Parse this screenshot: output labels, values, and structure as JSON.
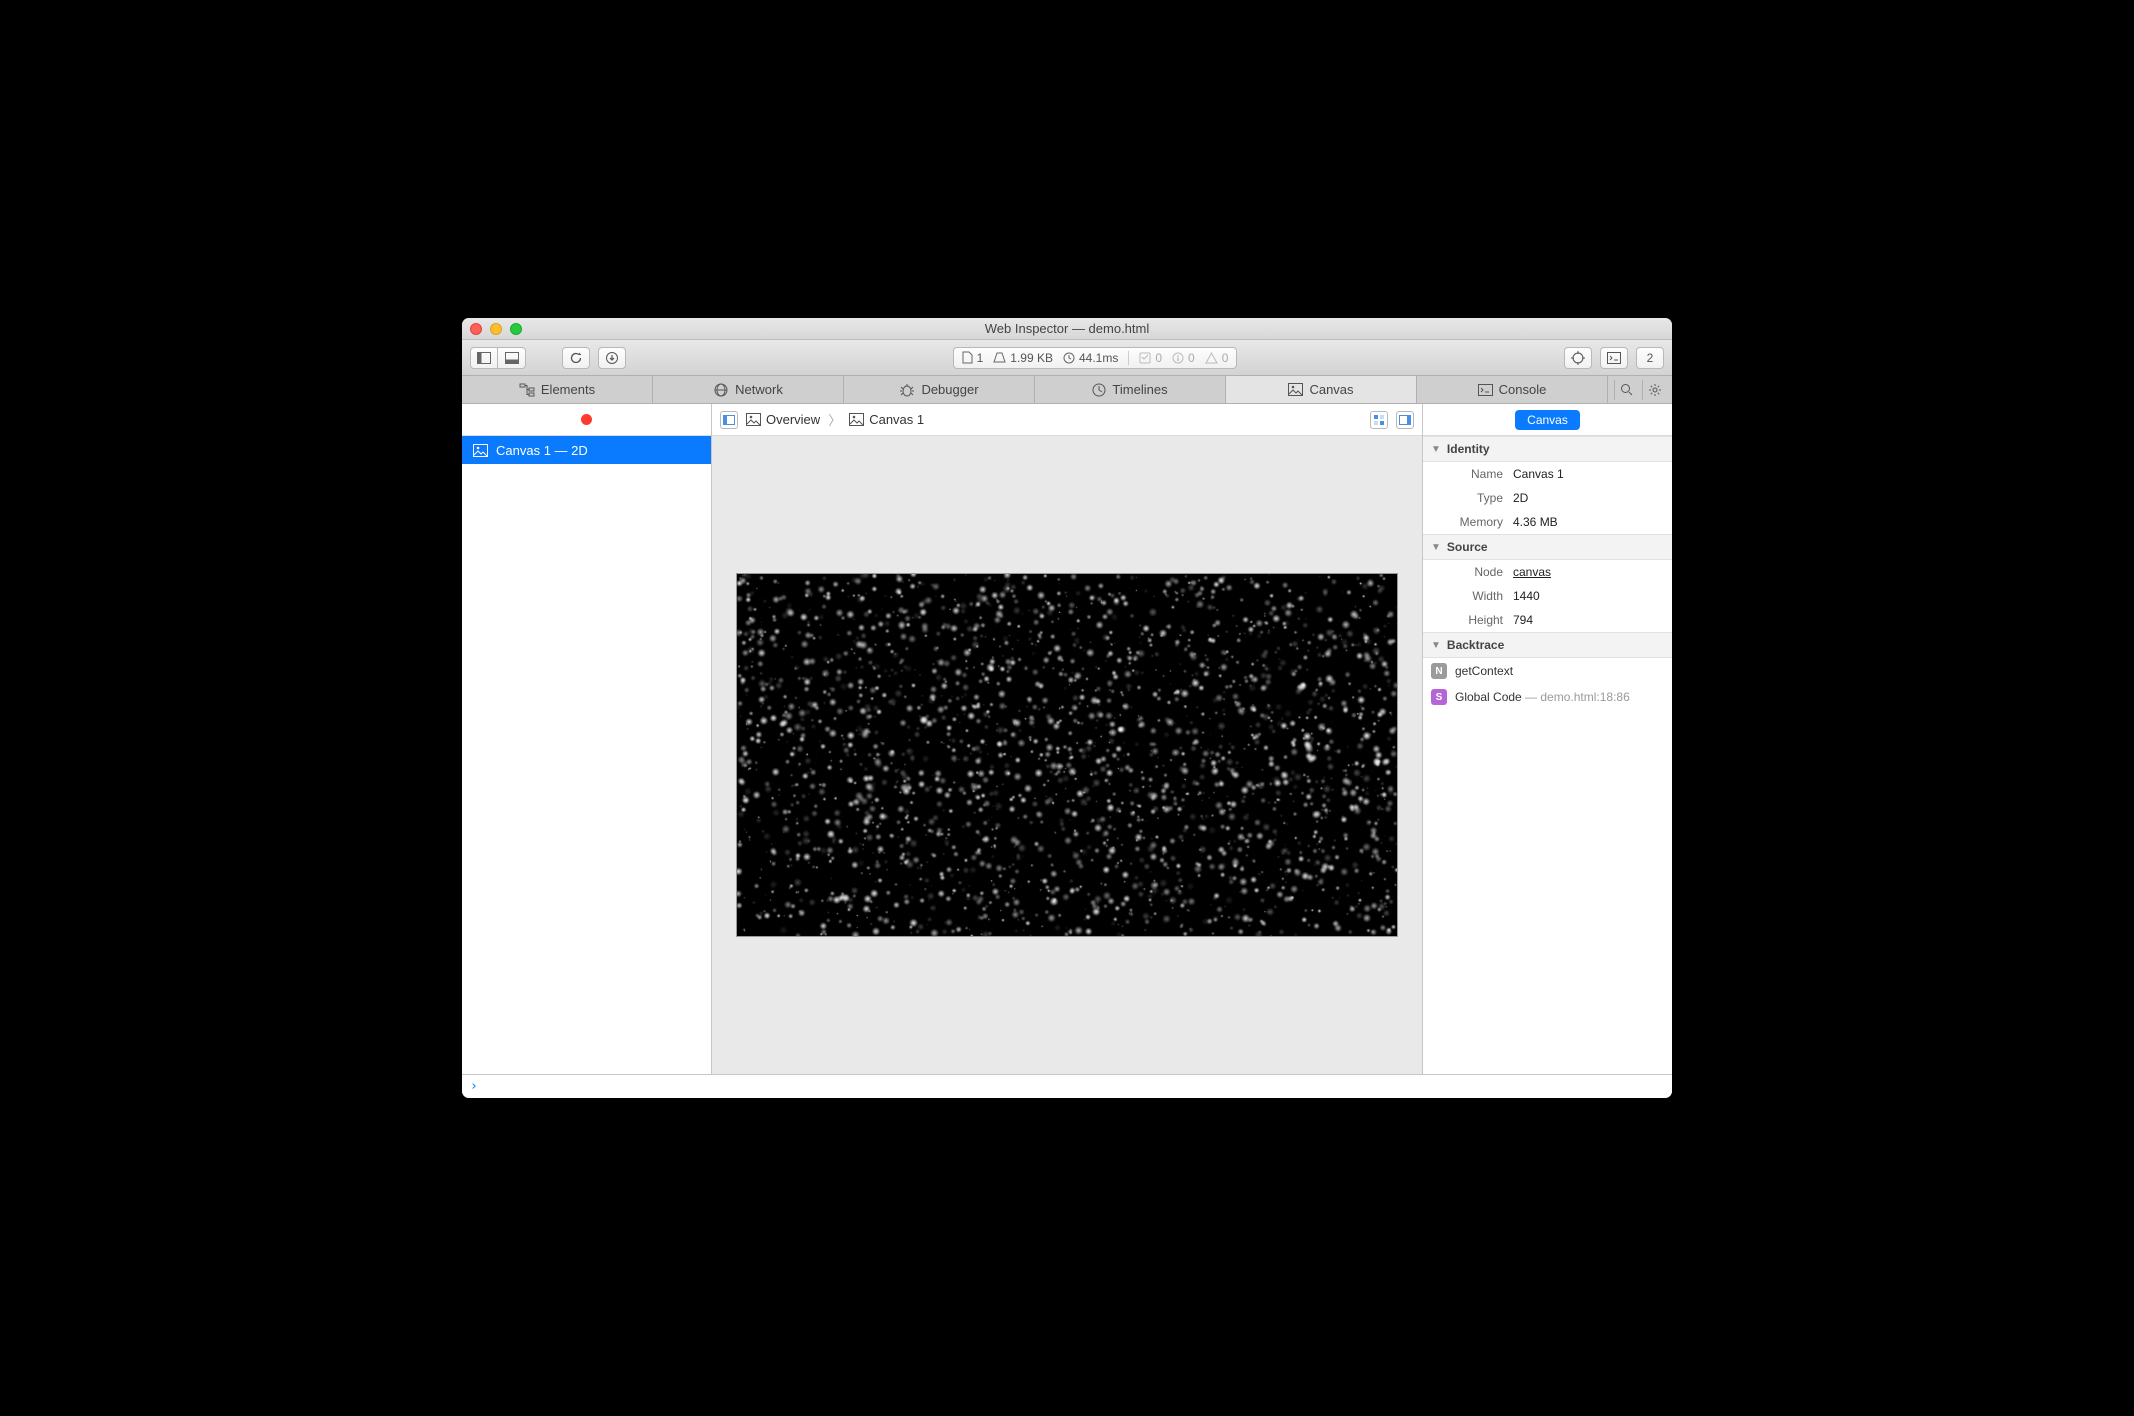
{
  "window": {
    "title": "Web Inspector — demo.html"
  },
  "toolbar": {
    "resources_count": "1",
    "size": "1.99 KB",
    "time": "44.1ms",
    "logs": "0",
    "issues": "0",
    "warnings": "0",
    "counter_right": "2"
  },
  "tabs": {
    "elements": "Elements",
    "network": "Network",
    "debugger": "Debugger",
    "timelines": "Timelines",
    "canvas": "Canvas",
    "console": "Console"
  },
  "sidebar": {
    "items": [
      {
        "label": "Canvas 1 — 2D"
      }
    ]
  },
  "pathbar": {
    "overview": "Overview",
    "current": "Canvas 1"
  },
  "inspector": {
    "scope_label": "Canvas",
    "identity": {
      "title": "Identity",
      "name_label": "Name",
      "name": "Canvas 1",
      "type_label": "Type",
      "type": "2D",
      "memory_label": "Memory",
      "memory": "4.36 MB"
    },
    "source": {
      "title": "Source",
      "node_label": "Node",
      "node": "canvas",
      "width_label": "Width",
      "width": "1440",
      "height_label": "Height",
      "height": "794"
    },
    "backtrace": {
      "title": "Backtrace",
      "frame0": "getContext",
      "frame1_a": "Global Code",
      "frame1_b": " — demo.html:18:86"
    }
  },
  "console": {
    "prompt": "›"
  }
}
